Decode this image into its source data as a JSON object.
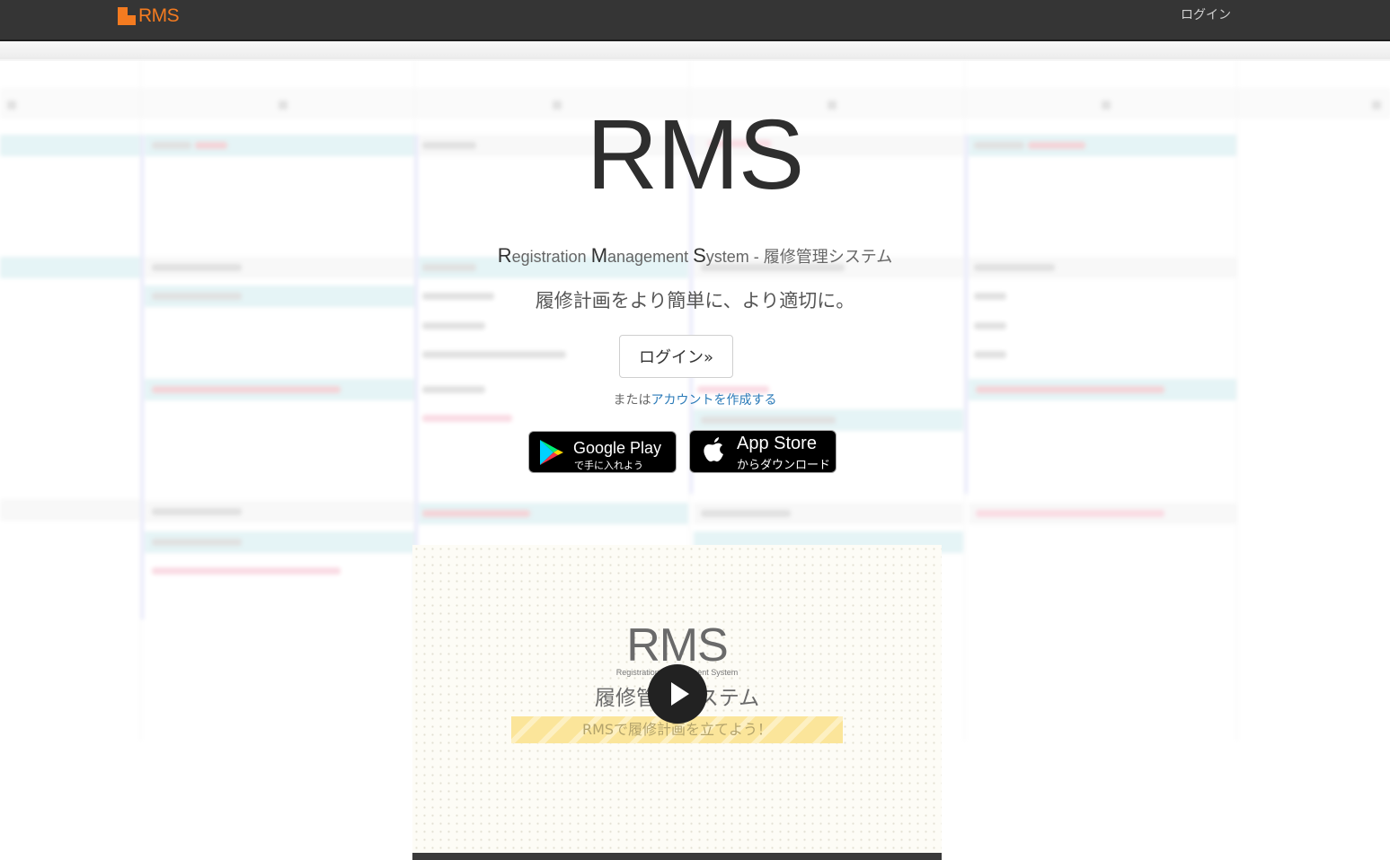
{
  "navbar": {
    "brand_text": "RMS",
    "login_label": "ログイン"
  },
  "hero": {
    "title": "RMS",
    "subtitle": {
      "r_cap": "R",
      "r_rest": "egistration ",
      "m_cap": "M",
      "m_rest": "anagement ",
      "s_cap": "S",
      "s_rest": "ystem",
      "suffix": " - 履修管理システム"
    },
    "tagline": "履修計画をより簡単に、より適切に。",
    "login_button": "ログイン»",
    "or_text": "または",
    "create_account_link": "アカウントを作成する"
  },
  "stores": {
    "google_play": {
      "big": "Google Play",
      "small": "で手に入れよう",
      "icon": "google-play-icon"
    },
    "app_store": {
      "big": "App Store",
      "small": "からダウンロード",
      "icon": "apple-icon"
    }
  },
  "video": {
    "logo": "RMS",
    "logo_sub": "Registration Management System",
    "title": "履修管理システム",
    "banner": "RMSで履修計画を立てよう！",
    "play_icon": "play-icon"
  },
  "colors": {
    "navbar_bg": "#353535",
    "brand": "#f47b20",
    "link": "#2a7ab8"
  }
}
